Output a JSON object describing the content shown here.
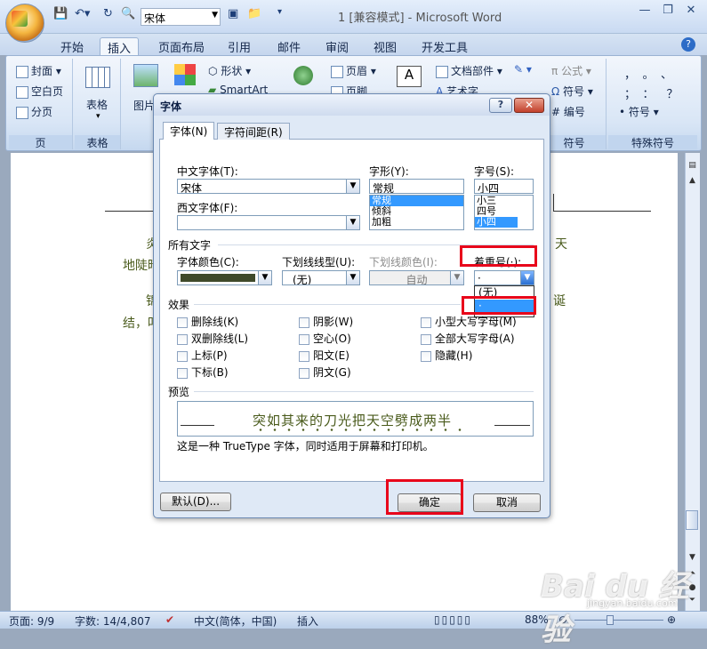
{
  "window": {
    "title": "1 [兼容模式] - Microsoft Word",
    "font_name": "宋体",
    "qat_icons": [
      "save-icon",
      "undo-icon",
      "redo-icon",
      "print-preview-icon"
    ]
  },
  "tabs": [
    "开始",
    "插入",
    "页面布局",
    "引用",
    "邮件",
    "审阅",
    "视图",
    "开发工具"
  ],
  "active_tab": "插入",
  "ribbon": {
    "pages": {
      "items": [
        "封面",
        "空白页",
        "分页"
      ],
      "label": "页"
    },
    "table": {
      "item": "表格",
      "label": "表格"
    },
    "illustrations": {
      "picture": "图片",
      "shapes": "形状",
      "smartart": "SmartArt"
    },
    "header_footer": {
      "header": "页眉",
      "footer": "页脚"
    },
    "text": {
      "parts": "文档部件",
      "art": "艺术字"
    },
    "symbols": {
      "formula": "公式",
      "symbol": "符号",
      "number": "编号",
      "label": "符号"
    },
    "special": {
      "row1": "，。、",
      "row2": "；：？",
      "symbol": "符号",
      "label": "特殊符号"
    }
  },
  "document": {
    "line1_start": "炎",
    "line1_end": "天",
    "line2": "地陡暗",
    "line3_start": "结，叩",
    "line3_end": "诞",
    "line4_char": "锦"
  },
  "dialog": {
    "title": "字体",
    "help": "?",
    "tabs": [
      "字体(N)",
      "字符间距(R)"
    ],
    "chinese_font_label": "中文字体(T):",
    "chinese_font_value": "宋体",
    "western_font_label": "西文字体(F):",
    "western_font_value": "",
    "style_label": "字形(Y):",
    "style_value": "常规",
    "style_list": [
      "常规",
      "倾斜",
      "加粗"
    ],
    "size_label": "字号(S):",
    "size_value": "小四",
    "size_list": [
      "小三",
      "四号",
      "小四"
    ],
    "all_text_label": "所有文字",
    "font_color_label": "字体颜色(C):",
    "underline_type_label": "下划线线型(U):",
    "underline_type_value": "(无)",
    "underline_color_label": "下划线颜色(I):",
    "underline_color_value": "自动",
    "emphasis_label": "着重号(·):",
    "emphasis_value": "·",
    "emphasis_options": [
      "(无)",
      "·"
    ],
    "effects_label": "效果",
    "effects_col1": [
      "删除线(K)",
      "双删除线(L)",
      "上标(P)",
      "下标(B)"
    ],
    "effects_col2": [
      "阴影(W)",
      "空心(O)",
      "阳文(E)",
      "阴文(G)"
    ],
    "effects_col3": [
      "小型大写字母(M)",
      "全部大写字母(A)",
      "隐藏(H)"
    ],
    "preview_label": "预览",
    "preview_text": "突如其来的刀光把天空劈成两半",
    "truetype_note": "这是一种 TrueType 字体，同时适用于屏幕和打印机。",
    "default_button": "默认(D)...",
    "ok_button": "确定",
    "cancel_button": "取消",
    "font_color": "#3f4a2a"
  },
  "status": {
    "page": "页面: 9/9",
    "words": "字数: 14/4,807",
    "language": "中文(简体，中国)",
    "mode": "插入",
    "zoom": "88%"
  },
  "watermark": {
    "main": "Bai du 经验",
    "sub": "jingyan.baidu.com"
  }
}
